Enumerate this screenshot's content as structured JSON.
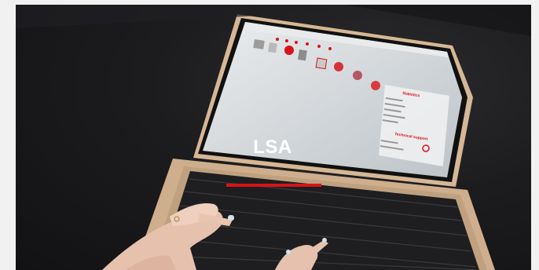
{
  "hero": {
    "title": "LSA"
  },
  "screen_app": {
    "panel_headings": [
      "Statistics",
      "Technical support"
    ]
  },
  "colors": {
    "accent": "#d7141a",
    "screen": "#d9dde0",
    "background": "#1c1c1e",
    "page": "#f1f1f1"
  },
  "icons": [
    "laptop-image",
    "toolbar-icons",
    "keyboard-image",
    "hands-image"
  ]
}
